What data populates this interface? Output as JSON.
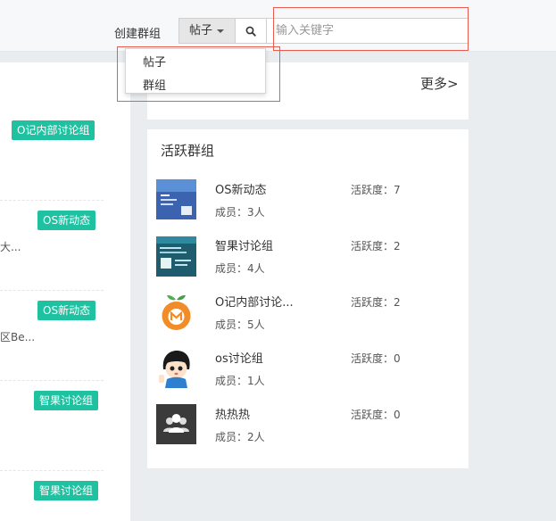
{
  "header": {
    "create_group": "创建群组",
    "search_type": "帖子",
    "search_placeholder": "输入关键字"
  },
  "dropdown": {
    "options": [
      "帖子",
      "群组"
    ]
  },
  "left_panel": {
    "tags": [
      "O记内部讨论组",
      "OS新动态",
      "OS新动态",
      "智果讨论组",
      "智果讨论组"
    ],
    "snippets": [
      "大...",
      "区Be..."
    ]
  },
  "top_card": {
    "more_label": "更多>"
  },
  "active_groups": {
    "title": "活跃群组",
    "groups": [
      {
        "name": "OS新动态",
        "members": "成员：3人",
        "activity": "活跃度：7",
        "avatar_icon": "blue-poster-image"
      },
      {
        "name": "智果讨论组",
        "members": "成员：4人",
        "activity": "活跃度：2",
        "avatar_icon": "teal-slide-image"
      },
      {
        "name": "O记内部讨论...",
        "members": "成员：5人",
        "activity": "活跃度：2",
        "avatar_icon": "orange-fruit-logo"
      },
      {
        "name": "os讨论组",
        "members": "成员：1人",
        "activity": "活跃度：0",
        "avatar_icon": "cartoon-girl-avatar"
      },
      {
        "name": "热热热",
        "members": "成员：2人",
        "activity": "活跃度：0",
        "avatar_icon": "group-people-icon"
      }
    ]
  },
  "colors": {
    "tag_green": "#1ec1a0",
    "highlight_red": "#e85c50"
  }
}
